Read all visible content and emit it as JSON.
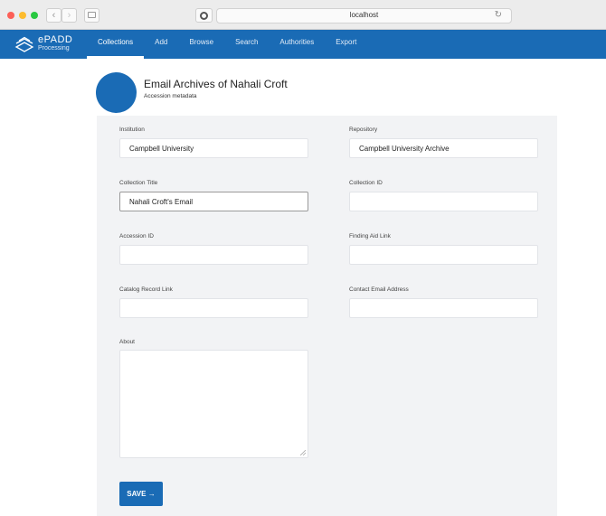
{
  "browser": {
    "url": "localhost",
    "back_icon": "‹",
    "forward_icon": "›",
    "reload_icon": "↻"
  },
  "app": {
    "logo_text": "ePADD",
    "logo_sub": "Processing",
    "nav": [
      {
        "label": "Collections",
        "active": true
      },
      {
        "label": "Add"
      },
      {
        "label": "Browse"
      },
      {
        "label": "Search"
      },
      {
        "label": "Authorities"
      },
      {
        "label": "Export"
      }
    ]
  },
  "header": {
    "title": "Email Archives of Nahali Croft",
    "subtitle": "Accession metadata"
  },
  "form": {
    "institution": {
      "label": "Institution",
      "value": "Campbell University"
    },
    "repository": {
      "label": "Repository",
      "value": "Campbell University Archive"
    },
    "collection_title": {
      "label": "Collection Title",
      "value": "Nahali Croft's Email"
    },
    "collection_id": {
      "label": "Collection ID",
      "value": ""
    },
    "accession_id": {
      "label": "Accession ID",
      "value": ""
    },
    "finding_aid_link": {
      "label": "Finding Aid Link",
      "value": ""
    },
    "catalog_record_link": {
      "label": "Catalog Record Link",
      "value": ""
    },
    "contact_email": {
      "label": "Contact Email Address",
      "value": ""
    },
    "about": {
      "label": "About",
      "value": ""
    },
    "save_label": "SAVE →"
  },
  "colors": {
    "brand": "#1a6bb5",
    "panel": "#f2f3f5"
  }
}
